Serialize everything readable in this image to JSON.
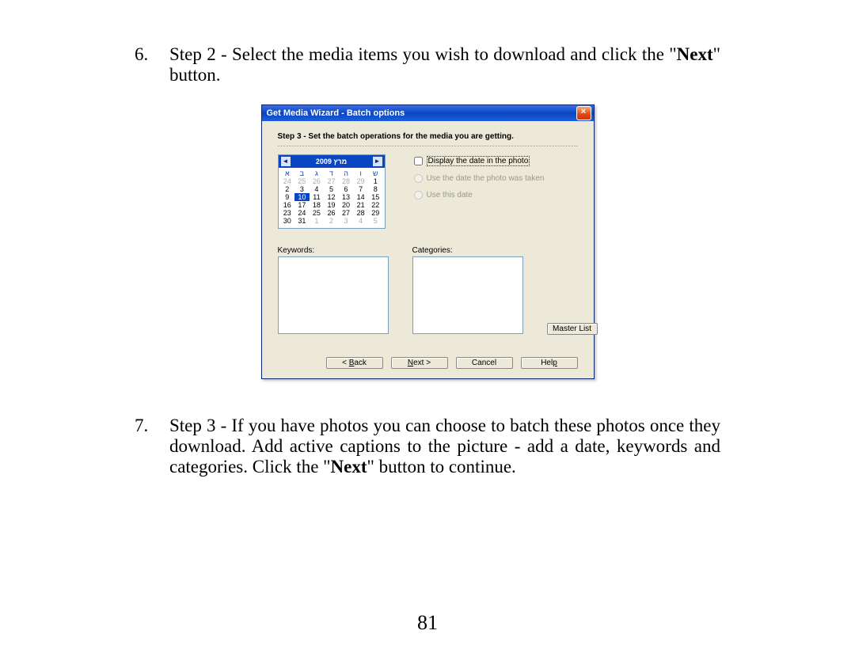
{
  "item6": {
    "num": "6.",
    "text_pre": "Step 2 - Select the media items you wish to download and click the \"",
    "bold": "Next",
    "text_post": "\" button."
  },
  "item7": {
    "num": "7.",
    "text_pre": "Step 3 - If you have photos you can choose to batch these photos once they download. Add active captions to the picture - add a date, keywords and categories. Click the \"",
    "bold": "Next",
    "text_post": "\" button to continue."
  },
  "page_number": "81",
  "dialog": {
    "title": "Get Media Wizard - Batch options",
    "step_line": "Step 3 - Set the batch operations for the media you are getting.",
    "calendar": {
      "header": "2009 מרץ",
      "dow": [
        "א",
        "ב",
        "ג",
        "ד",
        "ה",
        "ו",
        "ש"
      ],
      "rows": [
        [
          "24",
          "25",
          "26",
          "27",
          "28",
          "29",
          "1"
        ],
        [
          "2",
          "3",
          "4",
          "5",
          "6",
          "7",
          "8"
        ],
        [
          "9",
          "10",
          "11",
          "12",
          "13",
          "14",
          "15"
        ],
        [
          "16",
          "17",
          "18",
          "19",
          "20",
          "21",
          "22"
        ],
        [
          "23",
          "24",
          "25",
          "26",
          "27",
          "28",
          "29"
        ],
        [
          "30",
          "31",
          "1",
          "2",
          "3",
          "4",
          "5"
        ]
      ],
      "dim_first_row_count": 6,
      "dim_last_row_from_index": 2,
      "selected": "10"
    },
    "opts": {
      "display_date": "Display the date in the photo",
      "use_taken": "Use the date the photo was taken",
      "use_this": "Use this date"
    },
    "labels": {
      "keywords": "Keywords:",
      "categories": "Categories:",
      "master_list": "Master List"
    },
    "buttons": {
      "back_ul": "B",
      "back_rest": "ack",
      "back_prefix": "< ",
      "next_ul": "N",
      "next_rest": "ext >",
      "cancel": "Cancel",
      "help_ul": "p",
      "help_pre": "Hel"
    }
  }
}
